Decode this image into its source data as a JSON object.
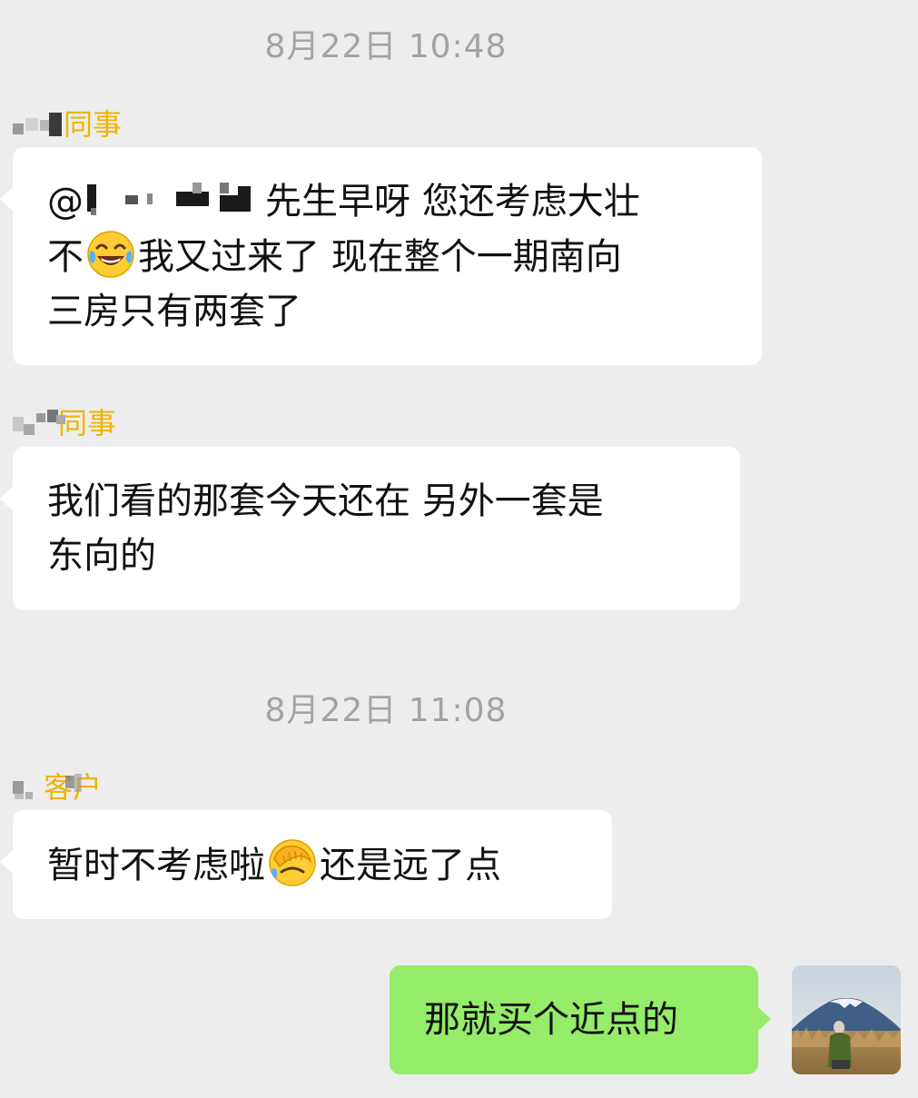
{
  "timestamps": [
    "8月22日 10:48",
    "8月22日 11:08"
  ],
  "messages": [
    {
      "sender_tag": "同事",
      "mention_prefix": "@",
      "line1_rest": "先生早呀  您还考虑大壮",
      "line2_pre": "不",
      "line2_emoji": "tears-of-joy-emoji",
      "line2_post": "我又过来了 现在整个一期南向",
      "line3": "三房只有两套了"
    },
    {
      "sender_tag": "同事",
      "line1": "我们看的那套今天还在 另外一套是",
      "line2": "东向的"
    },
    {
      "sender_tag": "客户",
      "pre": "暂时不考虑啦",
      "emoji": "facepalm-emoji",
      "post": "还是远了点"
    },
    {
      "text": "那就买个近点的"
    }
  ],
  "colors": {
    "background": "#ededed",
    "bubble_incoming": "#ffffff",
    "bubble_outgoing": "#95ec69",
    "sender_tag": "#f0b400",
    "timestamp": "#a3a3a3"
  }
}
